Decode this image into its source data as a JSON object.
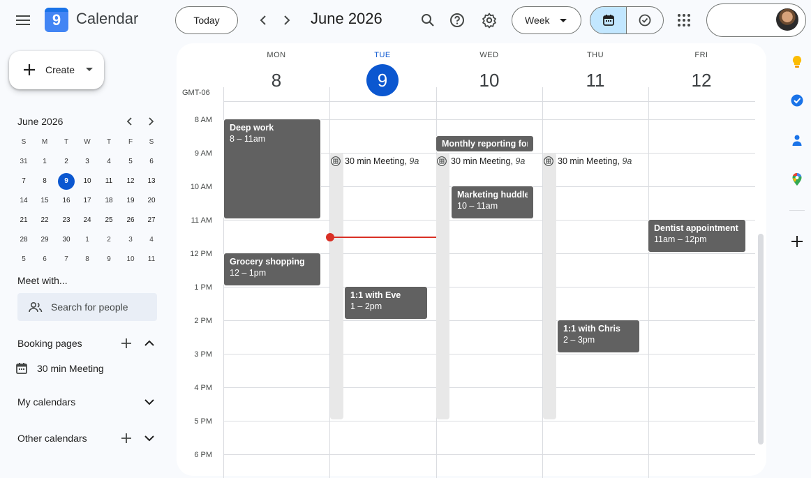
{
  "app": {
    "title": "Calendar",
    "logo_text": "9"
  },
  "header": {
    "today_label": "Today",
    "current_range": "June 2026",
    "view_label": "Week"
  },
  "create": {
    "label": "Create"
  },
  "mini_calendar": {
    "title": "June 2026",
    "weekdays": [
      "S",
      "M",
      "T",
      "W",
      "T",
      "F",
      "S"
    ],
    "weeks": [
      [
        "31",
        "1",
        "2",
        "3",
        "4",
        "5",
        "6"
      ],
      [
        "7",
        "8",
        "9",
        "10",
        "11",
        "12",
        "13"
      ],
      [
        "14",
        "15",
        "16",
        "17",
        "18",
        "19",
        "20"
      ],
      [
        "21",
        "22",
        "23",
        "24",
        "25",
        "26",
        "27"
      ],
      [
        "28",
        "29",
        "30",
        "1",
        "2",
        "3",
        "4"
      ],
      [
        "5",
        "6",
        "7",
        "8",
        "9",
        "10",
        "11"
      ]
    ],
    "today": "9"
  },
  "meet_with": {
    "title": "Meet with...",
    "search_placeholder": "Search for people"
  },
  "booking_pages": {
    "title": "Booking pages",
    "items": [
      {
        "label": "30 min Meeting"
      }
    ]
  },
  "my_calendars": {
    "title": "My calendars"
  },
  "other_calendars": {
    "title": "Other calendars"
  },
  "week": {
    "timezone": "GMT-06",
    "days": [
      {
        "name": "MON",
        "number": "8",
        "today": false
      },
      {
        "name": "TUE",
        "number": "9",
        "today": true
      },
      {
        "name": "WED",
        "number": "10",
        "today": false
      },
      {
        "name": "THU",
        "number": "11",
        "today": false
      },
      {
        "name": "FRI",
        "number": "12",
        "today": false
      }
    ],
    "hours": [
      "8 AM",
      "9 AM",
      "10 AM",
      "11 AM",
      "12 PM",
      "1 PM",
      "2 PM",
      "3 PM",
      "4 PM",
      "5 PM",
      "6 PM"
    ]
  },
  "events": {
    "deep_work": {
      "title": "Deep work",
      "time": "8 – 11am"
    },
    "grocery": {
      "title": "Grocery shopping",
      "time": "12 – 1pm"
    },
    "monthly_reporting": {
      "title": "Monthly reporting for a"
    },
    "marketing_huddle": {
      "title": "Marketing huddle",
      "time": "10 – 11am"
    },
    "dentist": {
      "title": "Dentist appointment",
      "time": "11am – 12pm"
    },
    "eve": {
      "title": "1:1 with Eve",
      "time": "1 – 2pm"
    },
    "chris": {
      "title": "1:1 with Chris",
      "time": "2 – 3pm"
    }
  },
  "appointment_schedule": {
    "label": "30 min Meeting",
    "time_suffix": "9a"
  },
  "colors": {
    "event": "#616161",
    "today": "#0b57d0",
    "now_line": "#d93025"
  }
}
